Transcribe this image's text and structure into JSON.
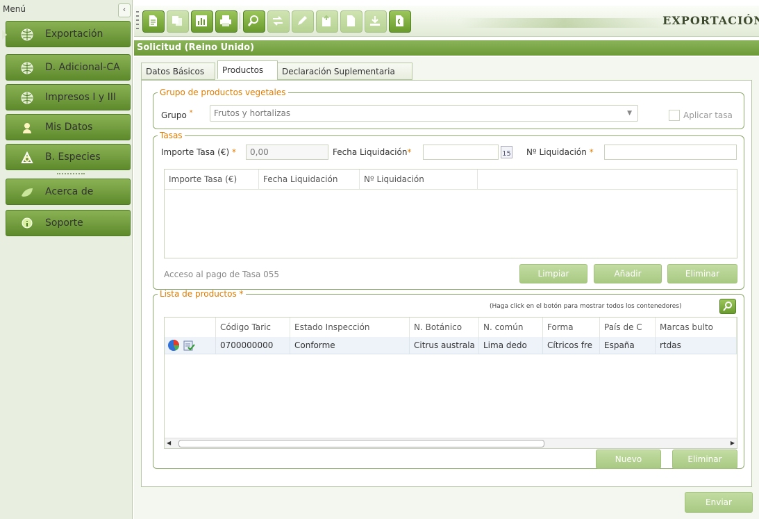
{
  "sidebar": {
    "title": "Menú",
    "collapse_label": "‹",
    "items": [
      {
        "label": "Exportación",
        "icon": "globe-icon"
      },
      {
        "label": "D. Adicional-CA",
        "icon": "globe-icon"
      },
      {
        "label": "Impresos I y III",
        "icon": "globe-icon"
      },
      {
        "label": "Mis Datos",
        "icon": "user-icon"
      },
      {
        "label": "B. Especies",
        "icon": "search-species-icon"
      },
      {
        "label": "Acerca de",
        "icon": "leaf-icon"
      },
      {
        "label": "Soporte",
        "icon": "info-icon"
      }
    ]
  },
  "toolbar": {
    "title": "EXPORTACIÓN",
    "buttons": [
      "document-icon",
      "copy-icon",
      "chart-icon",
      "print-icon",
      "search-icon",
      "transfer-icon",
      "edit-icon",
      "upload-doc-icon",
      "file-icon",
      "download-icon",
      "certificate-icon"
    ]
  },
  "request_header": "Solicitud (Reino Unido)",
  "tabs": [
    "Datos Básicos",
    "Productos",
    "Declaración Suplementaria"
  ],
  "grupo": {
    "legend": "Grupo de productos vegetales",
    "label": "Grupo",
    "required": "*",
    "value": "Frutos y hortalizas",
    "checkbox_label": "Aplicar tasa"
  },
  "tasas": {
    "legend": "Tasas",
    "importe_label": "Importe Tasa (€)",
    "importe_value": "0,00",
    "fecha_label": "Fecha Liquidación",
    "calendar_text": "15",
    "numero_label": "Nº Liquidación",
    "required": "*",
    "columns": [
      "Importe Tasa (€)",
      "Fecha Liquidación",
      "Nº Liquidación"
    ],
    "link": "Acceso al pago de Tasa 055",
    "buttons": {
      "limpiar": "Limpiar",
      "anadir": "Añadir",
      "eliminar": "Eliminar"
    }
  },
  "productos": {
    "legend": "Lista de productos",
    "required": "*",
    "hint": "(Haga click en el botón para mostrar todos los contenedores)",
    "columns": [
      "",
      "Código Taric",
      "Estado Inspección",
      "N. Botánico",
      "N. común",
      "Forma",
      "País de C",
      "Marcas bulto"
    ],
    "rows": [
      {
        "codigo": "0700000000",
        "estado": "Conforme",
        "botanico": "Citrus australa",
        "comun": "Lima dedo",
        "forma": "Cítricos fre",
        "pais": "España",
        "marcas": "rtdas"
      }
    ],
    "buttons": {
      "nuevo": "Nuevo",
      "eliminar": "Eliminar"
    }
  },
  "send_button": "Enviar",
  "colors": {
    "accent": "#6d9a38",
    "required": "#e07b00"
  }
}
